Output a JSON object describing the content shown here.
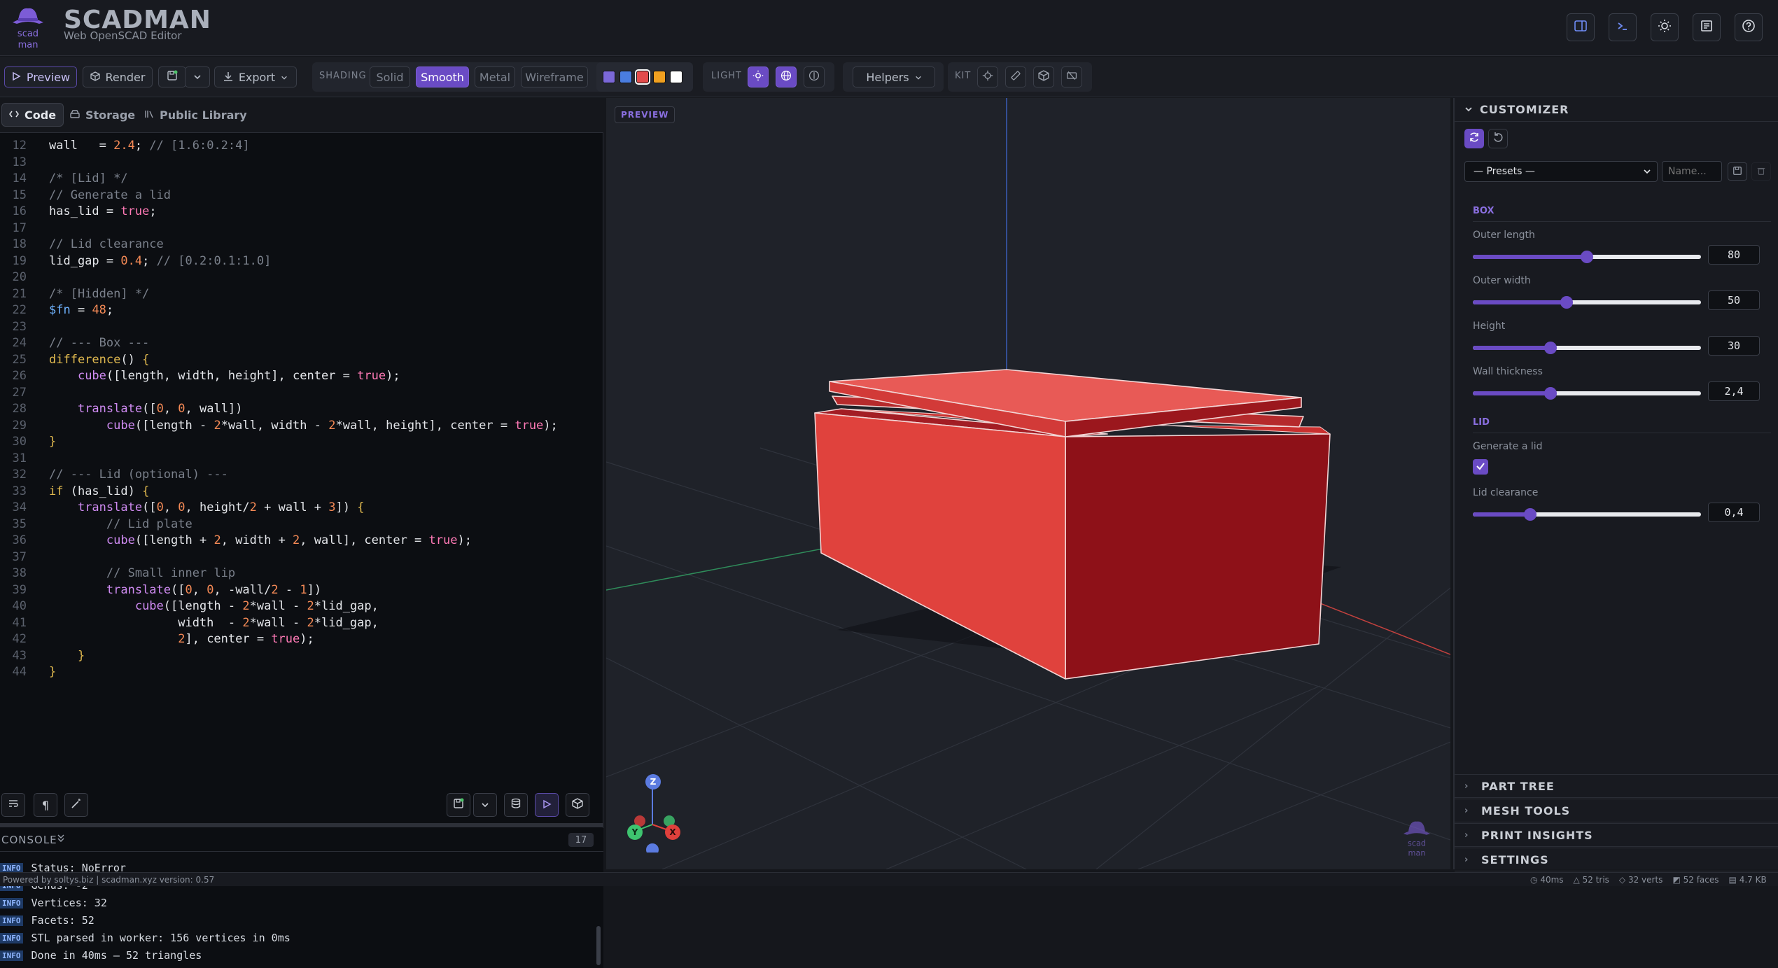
{
  "header": {
    "brand": "SCADMAN",
    "subtitle": "Web OpenSCAD Editor",
    "logo_text": "scad man"
  },
  "toolbar": {
    "preview_label": "Preview",
    "render_label": "Render",
    "export_label": "Export",
    "shading_label": "SHADING",
    "shading_options": [
      "Solid",
      "Smooth",
      "Metal",
      "Wireframe"
    ],
    "shading_selected": "Smooth",
    "colors": [
      "#7b68d8",
      "#4a7de0",
      "#e24c4c",
      "#f0a020",
      "#ffffff"
    ],
    "light_label": "LIGHT",
    "helpers_label": "Helpers",
    "kit_label": "KIT"
  },
  "editor": {
    "tabs": [
      "Code",
      "Storage",
      "Public Library"
    ],
    "active_tab": "Code",
    "lines": [
      {
        "n": "12",
        "t": "wall   = 2.4; // [1.6:0.2:4]"
      },
      {
        "n": "13",
        "t": ""
      },
      {
        "n": "14",
        "t": "/* [Lid] */"
      },
      {
        "n": "15",
        "t": "// Generate a lid"
      },
      {
        "n": "16",
        "t": "has_lid = true;"
      },
      {
        "n": "17",
        "t": ""
      },
      {
        "n": "18",
        "t": "// Lid clearance"
      },
      {
        "n": "19",
        "t": "lid_gap = 0.4; // [0.2:0.1:1.0]"
      },
      {
        "n": "20",
        "t": ""
      },
      {
        "n": "21",
        "t": "/* [Hidden] */"
      },
      {
        "n": "22",
        "t": "$fn = 48;"
      },
      {
        "n": "23",
        "t": ""
      },
      {
        "n": "24",
        "t": "// --- Box ---"
      },
      {
        "n": "25",
        "t": "difference() {"
      },
      {
        "n": "26",
        "t": "    cube([length, width, height], center = true);"
      },
      {
        "n": "27",
        "t": ""
      },
      {
        "n": "28",
        "t": "    translate([0, 0, wall])"
      },
      {
        "n": "29",
        "t": "        cube([length - 2*wall, width - 2*wall, height], center = true);"
      },
      {
        "n": "30",
        "t": "}"
      },
      {
        "n": "31",
        "t": ""
      },
      {
        "n": "32",
        "t": "// --- Lid (optional) ---"
      },
      {
        "n": "33",
        "t": "if (has_lid) {"
      },
      {
        "n": "34",
        "t": "    translate([0, 0, height/2 + wall + 3]) {"
      },
      {
        "n": "35",
        "t": "        // Lid plate"
      },
      {
        "n": "36",
        "t": "        cube([length + 2, width + 2, wall], center = true);"
      },
      {
        "n": "37",
        "t": ""
      },
      {
        "n": "38",
        "t": "        // Small inner lip"
      },
      {
        "n": "39",
        "t": "        translate([0, 0, -wall/2 - 1])"
      },
      {
        "n": "40",
        "t": "            cube([length - 2*wall - 2*lid_gap,"
      },
      {
        "n": "41",
        "t": "                  width  - 2*wall - 2*lid_gap,"
      },
      {
        "n": "42",
        "t": "                  2], center = true);"
      },
      {
        "n": "43",
        "t": "    }"
      },
      {
        "n": "44",
        "t": "}"
      }
    ]
  },
  "console": {
    "title": "CONSOLE",
    "count": "17",
    "level": "INFO",
    "messages": [
      "Status: NoError",
      "Genus: -2",
      "Vertices: 32",
      "Facets: 52",
      "STL parsed in worker: 156 vertices in 0ms",
      "Done in 40ms — 52 triangles"
    ]
  },
  "viewport": {
    "badge": "PREVIEW",
    "axes": {
      "z": "Z",
      "y": "Y",
      "x": "X"
    },
    "watermark": "scad man"
  },
  "customizer": {
    "title": "CUSTOMIZER",
    "presets_label": "— Presets —",
    "name_placeholder": "Name...",
    "box_group": "BOX",
    "lid_group": "LID",
    "params": [
      {
        "label": "Outer length",
        "value": "80",
        "fraction": 0.5
      },
      {
        "label": "Outer width",
        "value": "50",
        "fraction": 0.41
      },
      {
        "label": "Height",
        "value": "30",
        "fraction": 0.34
      },
      {
        "label": "Wall thickness",
        "value": "2,4",
        "fraction": 0.34
      }
    ],
    "generate_lid_label": "Generate a lid",
    "generate_lid_checked": true,
    "lid_clearance": {
      "label": "Lid clearance",
      "value": "0,4",
      "fraction": 0.25
    },
    "sections": [
      "PART TREE",
      "MESH TOOLS",
      "PRINT INSIGHTS",
      "SETTINGS"
    ]
  },
  "status": {
    "powered": "Powered by soltys.biz | scadman.xyz version: 0.57",
    "time": "40ms",
    "tris": "52 tris",
    "verts": "32 verts",
    "faces": "52 faces",
    "size": "4.7 KB"
  }
}
